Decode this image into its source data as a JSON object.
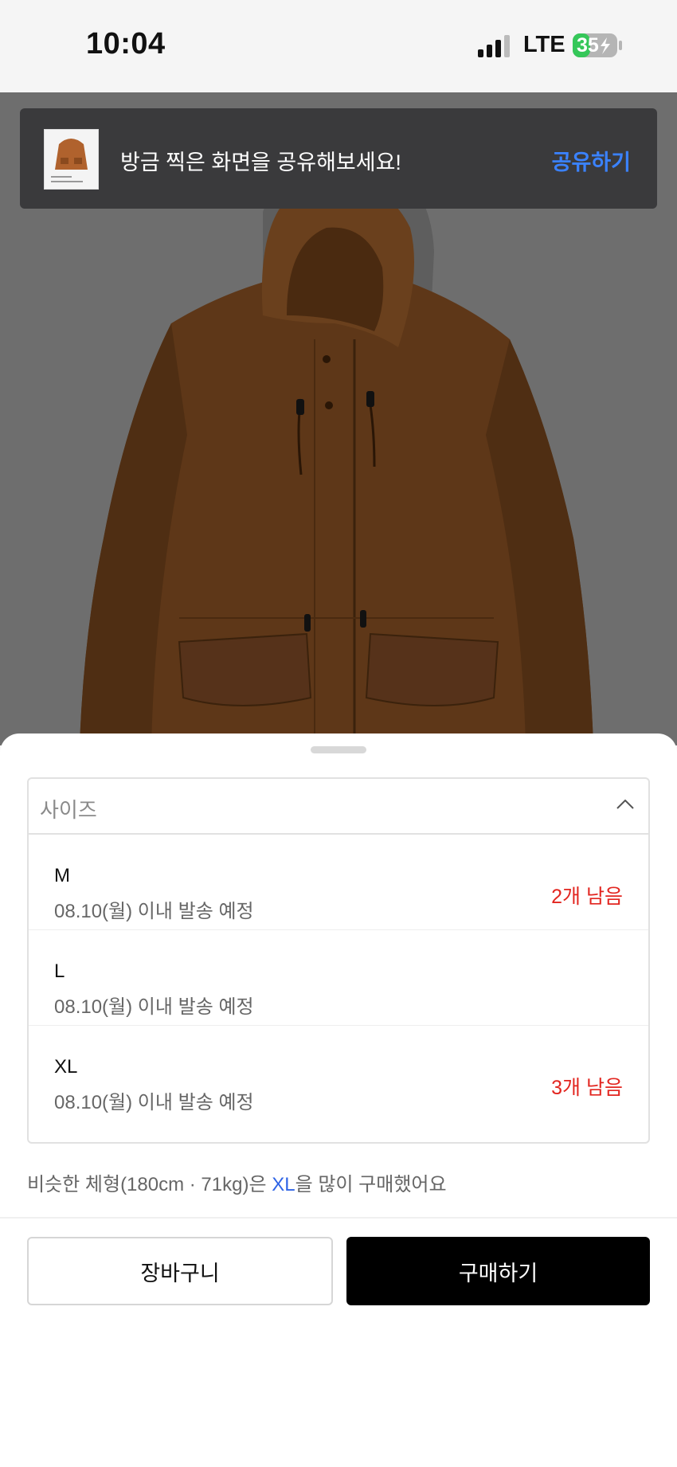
{
  "status_bar": {
    "time": "10:04",
    "network": "LTE",
    "battery": "35",
    "signal_icon": "signal-bars-icon",
    "battery_icon": "battery-charging-icon"
  },
  "product": {
    "image": "brown-hooded-jacket",
    "colors": {
      "jacket": "#7a4a24",
      "background": "#6e6e6e"
    }
  },
  "toast": {
    "message": "방금 찍은 화면을 공유해보세요!",
    "action": "공유하기",
    "action_color": "#3a82ff"
  },
  "size_sheet": {
    "placeholder": "사이즈",
    "toggle_icon": "chevron-up-icon",
    "items": [
      {
        "size": "M",
        "shipping": "08.10(월) 이내 발송 예정",
        "stock": "2개 남음"
      },
      {
        "size": "L",
        "shipping": "08.10(월) 이내 발송 예정",
        "stock": ""
      },
      {
        "size": "XL",
        "shipping": "08.10(월) 이내 발송 예정",
        "stock": "3개 남음"
      }
    ],
    "stock_color": "#e2251f"
  },
  "recommendation": {
    "prefix": "비슷한 체형(180cm · 71kg)은 ",
    "size": "XL",
    "suffix": "을 많이 구매했어요",
    "highlight_color": "#2f64e6"
  },
  "actions": {
    "cart": "장바구니",
    "buy": "구매하기"
  }
}
